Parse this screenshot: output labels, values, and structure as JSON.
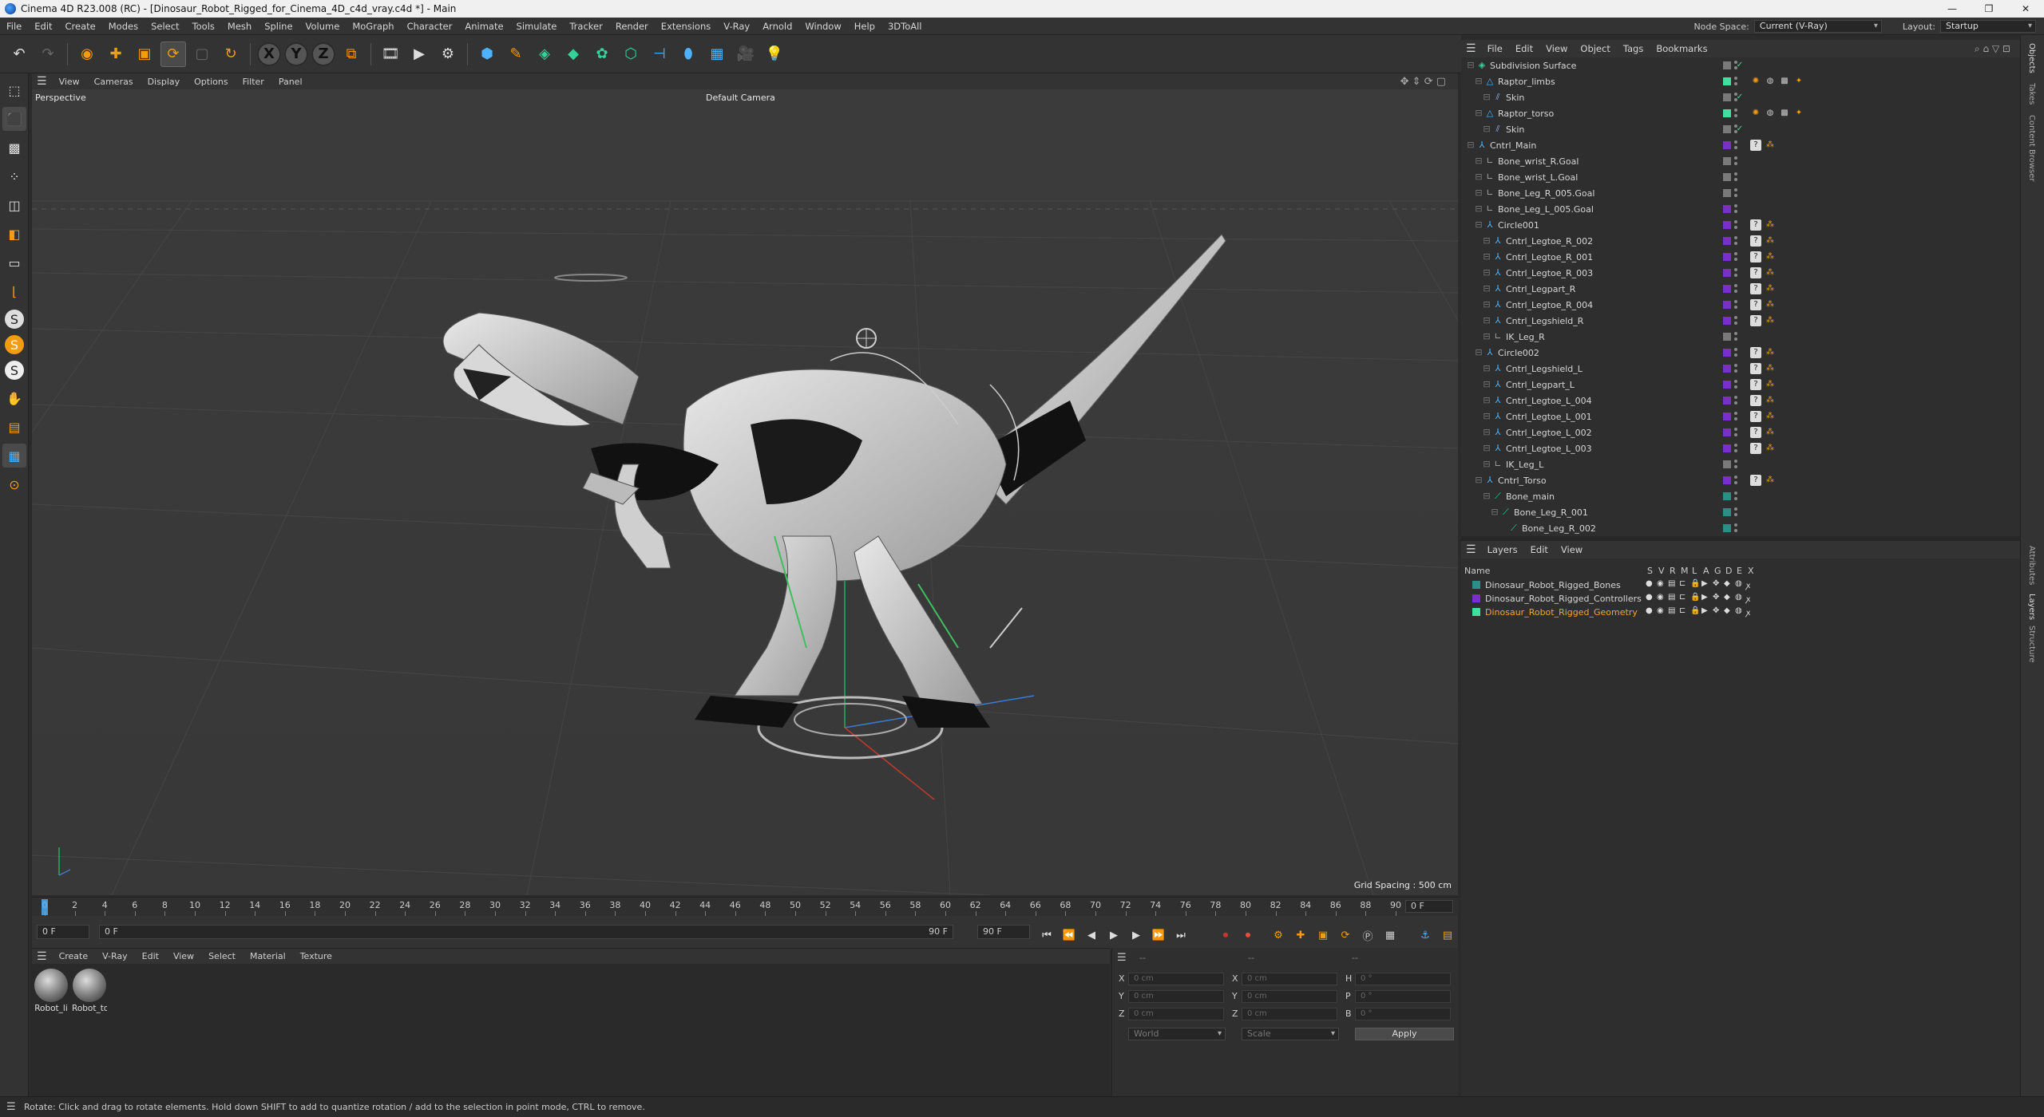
{
  "window": {
    "title": "Cinema 4D R23.008 (RC) - [Dinosaur_Robot_Rigged_for_Cinema_4D_c4d_vray.c4d *] - Main",
    "controls": [
      "—",
      "❐",
      "✕"
    ]
  },
  "menu": {
    "items": [
      "File",
      "Edit",
      "Create",
      "Modes",
      "Select",
      "Tools",
      "Mesh",
      "Spline",
      "Volume",
      "MoGraph",
      "Character",
      "Animate",
      "Simulate",
      "Tracker",
      "Render",
      "Extensions",
      "V-Ray",
      "Arnold",
      "Window",
      "Help",
      "3DToAll"
    ],
    "node_space_label": "Node Space:",
    "node_space_value": "Current (V-Ray)",
    "layout_label": "Layout:",
    "layout_value": "Startup"
  },
  "toolbar": {
    "axes": [
      "X",
      "Y",
      "Z"
    ]
  },
  "viewport": {
    "menu": [
      "View",
      "Cameras",
      "Display",
      "Options",
      "Filter",
      "Panel"
    ],
    "projection": "Perspective",
    "camera": "Default Camera",
    "grid_spacing": "Grid Spacing : 500 cm"
  },
  "timeline": {
    "ticks": [
      "0",
      "2",
      "4",
      "6",
      "8",
      "10",
      "12",
      "14",
      "16",
      "18",
      "20",
      "22",
      "24",
      "26",
      "28",
      "30",
      "32",
      "34",
      "36",
      "38",
      "40",
      "42",
      "44",
      "46",
      "48",
      "50",
      "52",
      "54",
      "56",
      "58",
      "60",
      "62",
      "64",
      "66",
      "68",
      "70",
      "72",
      "74",
      "76",
      "78",
      "80",
      "82",
      "84",
      "86",
      "88",
      "90"
    ],
    "current_frame": "0 F",
    "start_frame": "0 F",
    "range_start": "0 F",
    "range_end": "90 F",
    "end_frame": "90 F"
  },
  "materials": {
    "menu": [
      "Create",
      "V-Ray",
      "Edit",
      "View",
      "Select",
      "Material",
      "Texture"
    ],
    "items": [
      "Robot_li",
      "Robot_to"
    ]
  },
  "coordinates": {
    "header1": "--",
    "header2": "--",
    "header3": "--",
    "pos_labels": [
      "X",
      "Y",
      "Z"
    ],
    "pos_values": [
      "0 cm",
      "0 cm",
      "0 cm"
    ],
    "size_labels": [
      "X",
      "Y",
      "Z"
    ],
    "size_values": [
      "0 cm",
      "0 cm",
      "0 cm"
    ],
    "rot_labels": [
      "H",
      "P",
      "B"
    ],
    "rot_values": [
      "0 °",
      "0 °",
      "0 °"
    ],
    "mode": "World",
    "size_mode": "Scale",
    "apply": "Apply"
  },
  "object_manager": {
    "menu": [
      "File",
      "Edit",
      "View",
      "Object",
      "Tags",
      "Bookmarks"
    ],
    "objects": [
      {
        "name": "Subdivision Surface",
        "indent": 0,
        "color": "#7a7a7a",
        "icon": "subdivision-icon"
      },
      {
        "name": "Raptor_limbs",
        "indent": 1,
        "color": "#3ee0a0",
        "icon": "polygon-icon"
      },
      {
        "name": "Skin",
        "indent": 2,
        "color": "#7a7a7a",
        "icon": "skin-icon"
      },
      {
        "name": "Raptor_torso",
        "indent": 1,
        "color": "#3ee0a0",
        "icon": "polygon-icon"
      },
      {
        "name": "Skin",
        "indent": 2,
        "color": "#7a7a7a",
        "icon": "skin-icon"
      },
      {
        "name": "Cntrl_Main",
        "indent": 0,
        "color": "#7b2fc9",
        "icon": "null-icon"
      },
      {
        "name": "Bone_wrist_R.Goal",
        "indent": 1,
        "color": "#7a7a7a",
        "icon": "goal-icon"
      },
      {
        "name": "Bone_wrist_L.Goal",
        "indent": 1,
        "color": "#7a7a7a",
        "icon": "goal-icon"
      },
      {
        "name": "Bone_Leg_R_005.Goal",
        "indent": 1,
        "color": "#7a7a7a",
        "icon": "goal-icon"
      },
      {
        "name": "Bone_Leg_L_005.Goal",
        "indent": 1,
        "color": "#7b2fc9",
        "icon": "goal-icon"
      },
      {
        "name": "Circle001",
        "indent": 1,
        "color": "#7b2fc9",
        "icon": "null-icon"
      },
      {
        "name": "Cntrl_Legtoe_R_002",
        "indent": 2,
        "color": "#7b2fc9",
        "icon": "null-icon"
      },
      {
        "name": "Cntrl_Legtoe_R_001",
        "indent": 2,
        "color": "#7b2fc9",
        "icon": "null-icon"
      },
      {
        "name": "Cntrl_Legtoe_R_003",
        "indent": 2,
        "color": "#7b2fc9",
        "icon": "null-icon"
      },
      {
        "name": "Cntrl_Legpart_R",
        "indent": 2,
        "color": "#7b2fc9",
        "icon": "null-icon"
      },
      {
        "name": "Cntrl_Legtoe_R_004",
        "indent": 2,
        "color": "#7b2fc9",
        "icon": "null-icon"
      },
      {
        "name": "Cntrl_Legshield_R",
        "indent": 2,
        "color": "#7b2fc9",
        "icon": "null-icon"
      },
      {
        "name": "IK_Leg_R",
        "indent": 2,
        "color": "#7a7a7a",
        "icon": "goal-icon"
      },
      {
        "name": "Circle002",
        "indent": 1,
        "color": "#7b2fc9",
        "icon": "null-icon"
      },
      {
        "name": "Cntrl_Legshield_L",
        "indent": 2,
        "color": "#7b2fc9",
        "icon": "null-icon"
      },
      {
        "name": "Cntrl_Legpart_L",
        "indent": 2,
        "color": "#7b2fc9",
        "icon": "null-icon"
      },
      {
        "name": "Cntrl_Legtoe_L_004",
        "indent": 2,
        "color": "#7b2fc9",
        "icon": "null-icon"
      },
      {
        "name": "Cntrl_Legtoe_L_001",
        "indent": 2,
        "color": "#7b2fc9",
        "icon": "null-icon"
      },
      {
        "name": "Cntrl_Legtoe_L_002",
        "indent": 2,
        "color": "#7b2fc9",
        "icon": "null-icon"
      },
      {
        "name": "Cntrl_Legtoe_L_003",
        "indent": 2,
        "color": "#7b2fc9",
        "icon": "null-icon"
      },
      {
        "name": "IK_Leg_L",
        "indent": 2,
        "color": "#7a7a7a",
        "icon": "goal-icon"
      },
      {
        "name": "Cntrl_Torso",
        "indent": 1,
        "color": "#7b2fc9",
        "icon": "null-icon"
      },
      {
        "name": "Bone_main",
        "indent": 2,
        "color": "#2a8f86",
        "icon": "bone-icon"
      },
      {
        "name": "Bone_Leg_R_001",
        "indent": 3,
        "color": "#2a8f86",
        "icon": "bone-icon"
      },
      {
        "name": "Bone_Leg_R_002",
        "indent": 4,
        "color": "#2a8f86",
        "icon": "bone-icon"
      }
    ]
  },
  "layers": {
    "menu": [
      "Layers",
      "Edit",
      "View"
    ],
    "column_name": "Name",
    "columns": [
      "S",
      "V",
      "R",
      "M",
      "L",
      "A",
      "G",
      "D",
      "E",
      "X"
    ],
    "items": [
      {
        "name": "Dinosaur_Robot_Rigged_Bones",
        "color": "#2a8f86",
        "active": false
      },
      {
        "name": "Dinosaur_Robot_Rigged_Controllers",
        "color": "#7b2fc9",
        "active": false
      },
      {
        "name": "Dinosaur_Robot_Rigged_Geometry",
        "color": "#3ee0a0",
        "active": true
      }
    ]
  },
  "side_tabs": [
    "Objects",
    "Takes",
    "Content Browser",
    "Attributes",
    "Layers",
    "Structure"
  ],
  "status": "Rotate: Click and drag to rotate elements. Hold down SHIFT to add to quantize rotation / add to the selection in point mode, CTRL to remove.",
  "colors": {
    "accent_orange": "#f39c12",
    "active_layer": "#f0a830",
    "timeline_marker": "#4db3ff"
  }
}
